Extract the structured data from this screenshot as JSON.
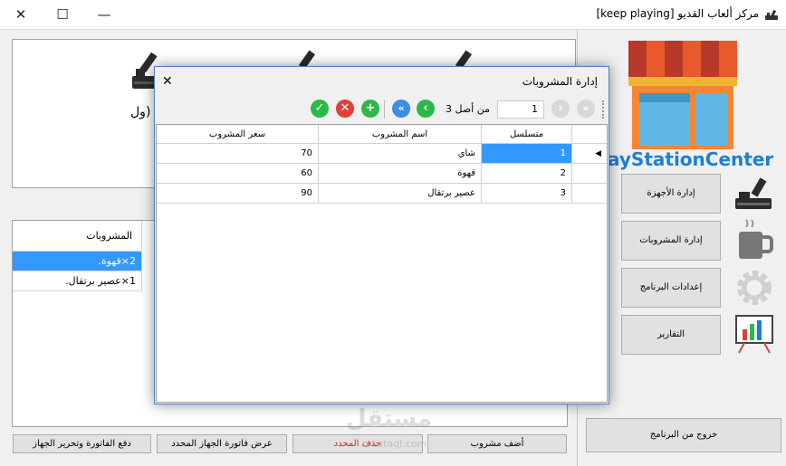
{
  "window": {
    "title": "مركز ألعاب القديو [keep playing]",
    "close": "✕",
    "maximize": "☐",
    "minimize": "—"
  },
  "devices_panel": {
    "partial_label": "ول)"
  },
  "orders_table": {
    "header": "المشروبات",
    "rows": [
      "2×قهوة.",
      "1×عصير برتقال."
    ]
  },
  "bottom_buttons": {
    "add_drink": "أضف مشروب",
    "delete_selected": "حذف المحدد",
    "show_invoice": "عرض فاتورة الجهاز المحدد",
    "pay_invoice": "دفع الفاتورة وتحرير الجهاز"
  },
  "sidebar": {
    "brand": "ayStationCenter",
    "buttons": [
      "إدارة الأجهزة",
      "إدارة المشروبات",
      "إعدادات البرنامج",
      "التقارير"
    ],
    "exit": "خروج من البرنامج"
  },
  "dialog": {
    "title": "إدارة المشروبات",
    "close": "✕",
    "nav": {
      "position": "1",
      "of_label": "من أصل 3"
    },
    "columns": [
      "متسلسل",
      "اسم المشروب",
      "سعر المشروب"
    ],
    "rows": [
      {
        "id": "1",
        "name": "شاي",
        "price": "70"
      },
      {
        "id": "2",
        "name": "قهوة",
        "price": "60"
      },
      {
        "id": "3",
        "name": "عصير برتقال",
        "price": "90"
      }
    ]
  },
  "watermark": {
    "text": "مستقل",
    "url": "mostaql.com"
  },
  "colors": {
    "selection": "#3399ff",
    "brand_blue": "#1c7fd6",
    "green": "#2db84a",
    "red": "#e0403a",
    "blue_nav": "#3a8ee6"
  }
}
